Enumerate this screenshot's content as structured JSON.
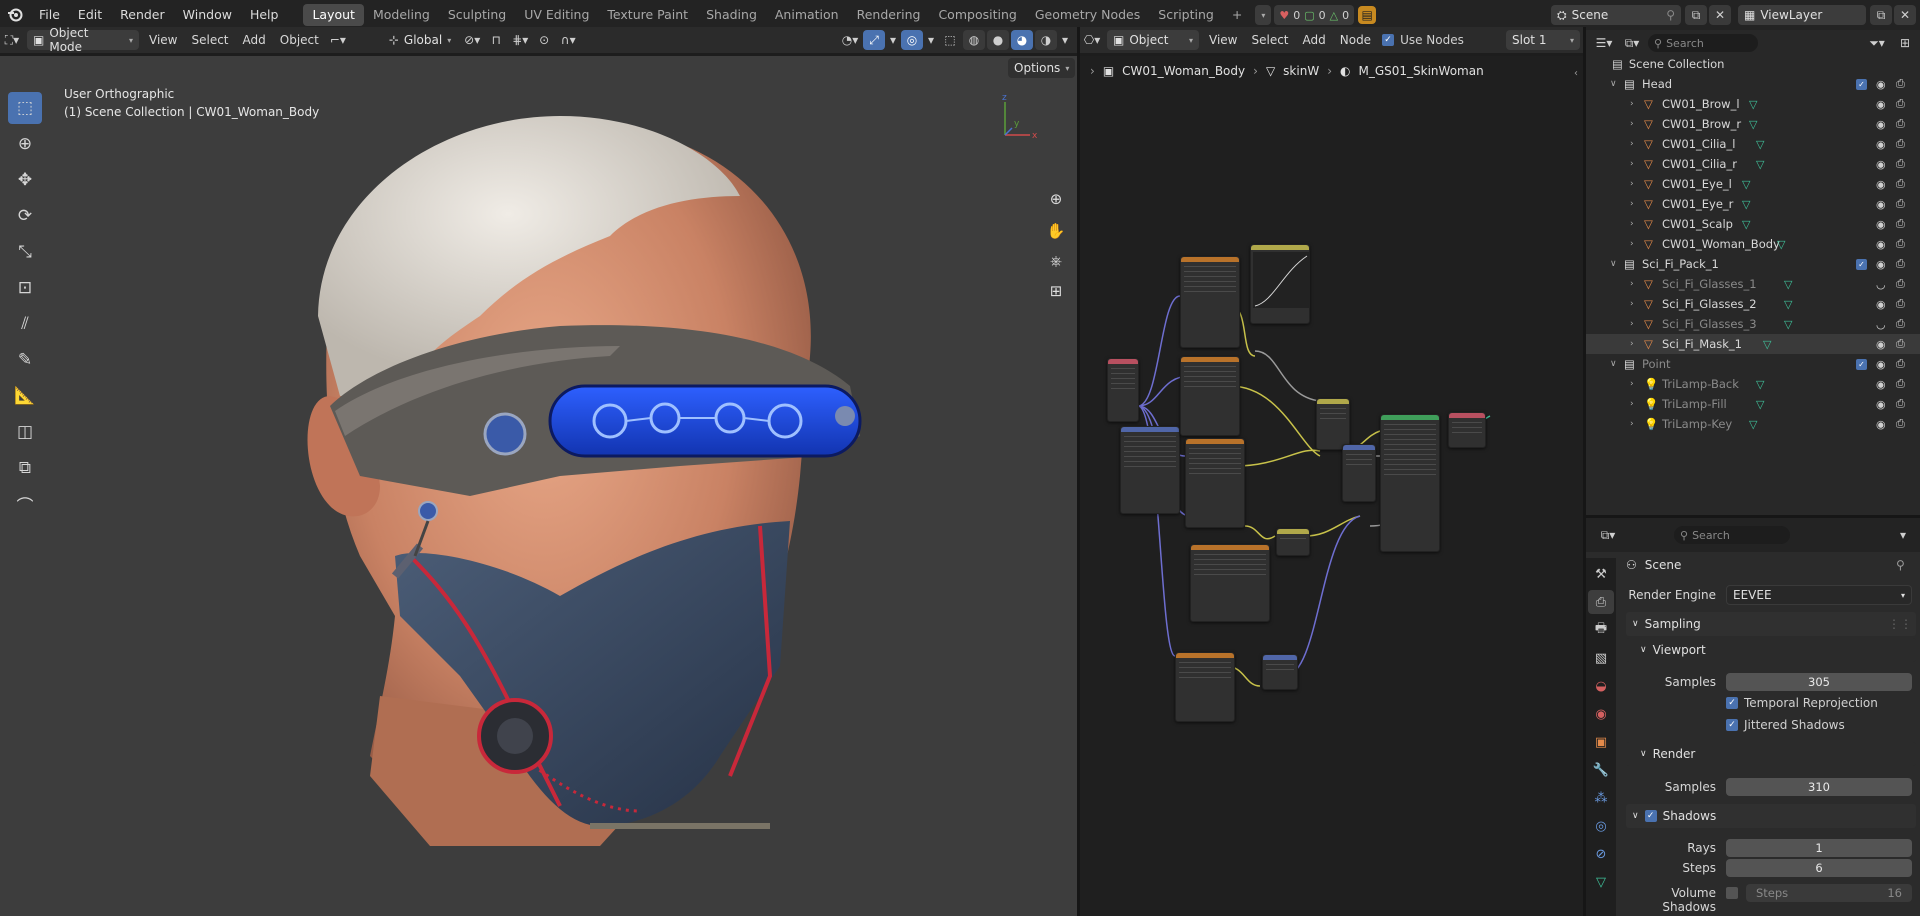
{
  "topbar": {
    "menus": [
      "File",
      "Edit",
      "Render",
      "Window",
      "Help"
    ],
    "workspaces": [
      "Layout",
      "Modeling",
      "Sculpting",
      "UV Editing",
      "Texture Paint",
      "Shading",
      "Animation",
      "Rendering",
      "Compositing",
      "Geometry Nodes",
      "Scripting"
    ],
    "active_workspace": "Layout",
    "stats": {
      "errors": "0",
      "objects": "0",
      "verts": "0"
    },
    "scene_name": "Scene",
    "view_layer": "ViewLayer"
  },
  "viewport_header": {
    "mode": "Object Mode",
    "menus": [
      "View",
      "Select",
      "Add",
      "Object"
    ],
    "transform_orientation": "Global",
    "options_label": "Options"
  },
  "viewport": {
    "view_name": "User Orthographic",
    "collection_info": "(1) Scene Collection | CW01_Woman_Body",
    "axis_labels": {
      "x": "x",
      "y": "y",
      "z": "z"
    }
  },
  "node_header": {
    "object_type": "Object",
    "menus": [
      "View",
      "Select",
      "Add",
      "Node"
    ],
    "use_nodes_label": "Use Nodes",
    "slot": "Slot 1"
  },
  "breadcrumb": {
    "object": "CW01_Woman_Body",
    "mesh": "skinW",
    "material": "M_GS01_SkinWoman"
  },
  "outliner": {
    "search_placeholder": "Search",
    "root": "Scene Collection",
    "rows": [
      {
        "label": "Head",
        "type": "collection",
        "indent": 1,
        "dim": false,
        "selected": false,
        "checkbox": true
      },
      {
        "label": "CW01_Brow_l",
        "type": "mesh",
        "indent": 2,
        "dim": false,
        "selected": false
      },
      {
        "label": "CW01_Brow_r",
        "type": "mesh",
        "indent": 2,
        "dim": false,
        "selected": false
      },
      {
        "label": "CW01_Cilia_l",
        "type": "mesh",
        "indent": 2,
        "dim": false,
        "selected": false
      },
      {
        "label": "CW01_Cilia_r",
        "type": "mesh",
        "indent": 2,
        "dim": false,
        "selected": false
      },
      {
        "label": "CW01_Eye_l",
        "type": "mesh",
        "indent": 2,
        "dim": false,
        "selected": false
      },
      {
        "label": "CW01_Eye_r",
        "type": "mesh",
        "indent": 2,
        "dim": false,
        "selected": false
      },
      {
        "label": "CW01_Scalp",
        "type": "mesh",
        "indent": 2,
        "dim": false,
        "selected": false
      },
      {
        "label": "CW01_Woman_Body",
        "type": "mesh",
        "indent": 2,
        "dim": false,
        "selected": false
      },
      {
        "label": "Sci_Fi_Pack_1",
        "type": "collection",
        "indent": 1,
        "dim": false,
        "selected": false,
        "checkbox": true
      },
      {
        "label": "Sci_Fi_Glasses_1",
        "type": "mesh",
        "indent": 2,
        "dim": true,
        "selected": false
      },
      {
        "label": "Sci_Fi_Glasses_2",
        "type": "mesh",
        "indent": 2,
        "dim": false,
        "selected": false
      },
      {
        "label": "Sci_Fi_Glasses_3",
        "type": "mesh",
        "indent": 2,
        "dim": true,
        "selected": false
      },
      {
        "label": "Sci_Fi_Mask_1",
        "type": "mesh",
        "indent": 2,
        "dim": false,
        "selected": true
      },
      {
        "label": "Point",
        "type": "collection",
        "indent": 1,
        "dim": true,
        "selected": false,
        "checkbox": true
      },
      {
        "label": "TriLamp-Back",
        "type": "light",
        "indent": 2,
        "dim": true,
        "selected": false
      },
      {
        "label": "TriLamp-Fill",
        "type": "light",
        "indent": 2,
        "dim": true,
        "selected": false
      },
      {
        "label": "TriLamp-Key",
        "type": "light",
        "indent": 2,
        "dim": true,
        "selected": false
      }
    ]
  },
  "properties": {
    "search_placeholder": "Search",
    "context": "Scene",
    "render_engine_label": "Render Engine",
    "render_engine": "EEVEE",
    "sampling": "Sampling",
    "viewport": "Viewport",
    "samples_label": "Samples",
    "viewport_samples": "305",
    "temporal_reprojection": "Temporal Reprojection",
    "jittered_shadows": "Jittered Shadows",
    "render": "Render",
    "render_samples": "310",
    "shadows": "Shadows",
    "rays_label": "Rays",
    "rays": "1",
    "steps_label": "Steps",
    "steps": "6",
    "volume_shadows_label": "Volume Shadows",
    "volume_steps_label": "Steps",
    "volume_steps": "16"
  },
  "colors": {
    "accent": "#4a72b0",
    "mesh_icon": "#e38a4a",
    "data_icon": "#3fc19a",
    "noodle_yellow": "#c8c24a",
    "noodle_purple": "#6e6ed0"
  }
}
